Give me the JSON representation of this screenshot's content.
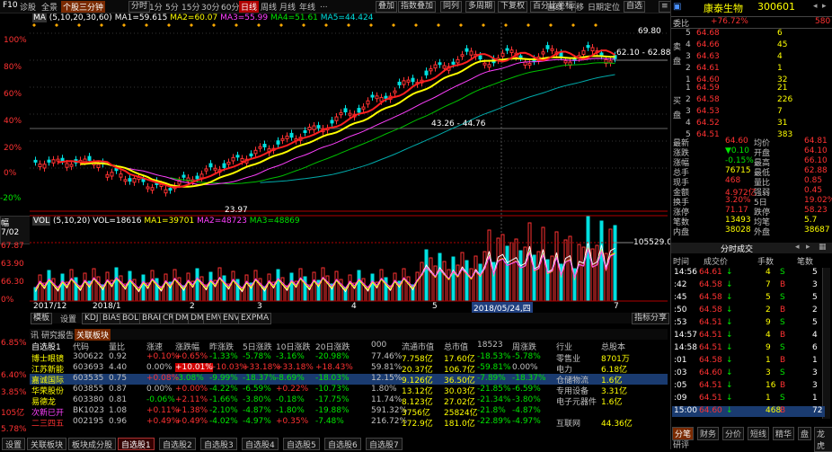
{
  "toolbar": {
    "f10": "F10",
    "diagnose": "诊股",
    "full": "全景",
    "stock_trend": "个股三分钟",
    "periods": [
      "分时",
      "1分",
      "5分",
      "15分",
      "30分",
      "60分",
      "日线",
      "周线",
      "月线",
      "年线"
    ],
    "more": "...",
    "overlay": "叠加",
    "indicator_overlay": "指数叠加",
    "same_list": "同列",
    "multi_cycle": "多周期",
    "adjust": "下复权",
    "range": "百分比坐标",
    "draw": "画线",
    "pan": "平移",
    "locate": "日期定位",
    "self_select": "自选"
  },
  "ma_legend": {
    "label": "MA",
    "params": "(5,10,20,30,60)",
    "ma1": "MA1=59.615",
    "ma2": "MA2=60.07",
    "ma3": "MA3=55.99",
    "ma4": "MA4=51.61",
    "ma5": "MA5=44.424"
  },
  "vol_legend": {
    "label": "VOL",
    "params": "(5,10,20)",
    "vol": "VOL=18616",
    "ma1": "MA1=39701",
    "ma2": "MA2=48723",
    "ma3": "MA3=48869",
    "peak": "105529.00"
  },
  "price_axis": [
    "100%",
    "80%",
    "60%",
    "40%",
    "20%",
    "0%",
    "-20%"
  ],
  "price_marks": {
    "high": "69.80",
    "range": "62.10 - 62.88",
    "mid": "43.26 - 44.76",
    "low": "23.97"
  },
  "time_axis": [
    "2017/12",
    "2018/1",
    "2",
    "3",
    "4",
    "5",
    "2018/05/24,四",
    "7"
  ],
  "indicator_tabs": [
    "模板",
    "设置",
    "KDJ",
    "BIAS",
    "BOLL",
    "BRAR",
    "CR",
    "DMA",
    "DMI",
    "EMV",
    "ENV",
    "EXPMA"
  ],
  "indicator_more": "指标分享",
  "left_info": [
    "幅",
    "7/02",
    "6.85%",
    "6.40%",
    "3.85%",
    "105亿",
    "5.78%",
    "65.00",
    "67.87",
    "63.90",
    "66.30",
    "0%"
  ],
  "left_side_labels": [
    "日线",
    "设置",
    "指标"
  ],
  "news_tabs": [
    "讯",
    "研究报告",
    "关联板块"
  ],
  "stock_title": {
    "name": "康泰生物",
    "code": "300601"
  },
  "ratio": {
    "label": "委比",
    "value": "+76.72%",
    "diff_label": "",
    "diff": "580"
  },
  "sell_orders": [
    {
      "level": "5",
      "price": "64.68",
      "vol": "6"
    },
    {
      "level": "4",
      "price": "64.66",
      "vol": "45"
    },
    {
      "level": "3",
      "price": "64.63",
      "vol": "4"
    },
    {
      "level": "2",
      "price": "64.61",
      "vol": "1"
    },
    {
      "level": "1",
      "price": "64.60",
      "vol": "32"
    }
  ],
  "buy_orders": [
    {
      "level": "1",
      "price": "64.59",
      "vol": "21"
    },
    {
      "level": "2",
      "price": "64.58",
      "vol": "226"
    },
    {
      "level": "3",
      "price": "64.53",
      "vol": "7"
    },
    {
      "level": "4",
      "price": "64.52",
      "vol": "31"
    },
    {
      "level": "5",
      "price": "64.51",
      "vol": "383"
    }
  ],
  "side_labels": {
    "sell": "卖盘",
    "buy": "买盘"
  },
  "quote": [
    [
      "最新",
      "64.60",
      "均价",
      "64.81"
    ],
    [
      "涨跌",
      "▼0.10",
      "开盘",
      "64.10"
    ],
    [
      "涨幅",
      "-0.15%",
      "最高",
      "66.10"
    ],
    [
      "总手",
      "76715",
      "最低",
      "62.88"
    ],
    [
      "现手",
      "468",
      "量比",
      "0.85"
    ],
    [
      "金额",
      "4.972亿",
      "强弱",
      "0.45"
    ],
    [
      "换手",
      "3.20%",
      "5日",
      "19.02%"
    ],
    [
      "涨停",
      "71.17",
      "跌停",
      "58.23"
    ],
    [
      "笔数",
      "13493",
      "均笔",
      "5.7"
    ],
    [
      "内盘",
      "38028",
      "外盘",
      "38687"
    ]
  ],
  "ticks_title": "分时成交",
  "ticks_header": [
    "时间",
    "成交价",
    "手数",
    "笔数"
  ],
  "ticks": [
    [
      "14:56",
      "64.61",
      "4",
      "5"
    ],
    [
      ":42",
      "64.58",
      "7",
      "3"
    ],
    [
      ":45",
      "64.58",
      "5",
      "5"
    ],
    [
      ":50",
      "64.58",
      "2",
      "2"
    ],
    [
      ":53",
      "64.51",
      "9",
      "5"
    ],
    [
      "14:57",
      "64.51",
      "4",
      "4"
    ],
    [
      "14:58",
      "64.51",
      "9",
      "6"
    ],
    [
      ":01",
      "64.58",
      "1",
      "1"
    ],
    [
      ":03",
      "64.60",
      "3",
      "3"
    ],
    [
      ":05",
      "64.51",
      "16",
      "3"
    ],
    [
      ":09",
      "64.51",
      "1",
      "1"
    ],
    [
      "15:00",
      "64.60",
      "468",
      "72"
    ]
  ],
  "bottom_right_tabs": [
    "分笔",
    "财务",
    "分价",
    "短线",
    "精华",
    "盘",
    "龙虎"
  ],
  "bottom_right_extra": "研评",
  "table_header": [
    "自选股1",
    "代码",
    "量比",
    "涨速",
    "涨跌幅",
    "昨涨跌",
    "5日涨跌",
    "10日涨跌",
    "20日涨跌",
    "000",
    "流通市值",
    "总市值",
    "18523",
    "周涨跌",
    "行业",
    "总股本"
  ],
  "table_rows": [
    [
      "博士眼镜",
      "300622",
      "0.92",
      "+0.10%",
      "+0.65%",
      "-1.33%",
      "-5.78%",
      "-3.16%",
      "-20.98%",
      "77.46%",
      "7.758亿",
      "17.60亿",
      "-18.53%",
      "-5.78%",
      "零售业",
      "8701万"
    ],
    [
      "江苏新能",
      "603693",
      "4.40",
      "0.00%",
      "+10.01%",
      "+10.03%",
      "+33.18%",
      "+33.18%",
      "+18.43%",
      "59.81%",
      "20.37亿",
      "106.7亿",
      "-59.81%",
      "0.00%",
      "电力",
      "6.18亿"
    ],
    [
      "嘉诚国际",
      "603535",
      "0.75",
      "+0.08%",
      "-3.08%",
      "-9.99%",
      "-18.37%",
      "-8.69%",
      "-18.03%",
      "12.15%",
      "9.126亿",
      "36.50亿",
      "-7.89%",
      "-18.37%",
      "仓储物流",
      "1.6亿"
    ],
    [
      "华荣股份",
      "603855",
      "0.87",
      "0.00%",
      "+0.00%",
      "-4.22%",
      "-6.59%",
      "+0.22%",
      "-10.73%",
      "1.80%",
      "13.12亿",
      "30.03亿",
      "-21.85%",
      "-6.59%",
      "专用设备",
      "3.31亿"
    ],
    [
      "易德龙",
      "603380",
      "0.81",
      "-0.06%",
      "+2.11%",
      "-1.66%",
      "-3.80%",
      "-0.18%",
      "-17.75%",
      "11.74%",
      "8.123亿",
      "27.02亿",
      "-21.34%",
      "-3.80%",
      "电子元器件",
      "1.6亿"
    ],
    [
      "次新已开",
      "BK1023",
      "1.08",
      "+0.11%",
      "+1.38%",
      "-2.10%",
      "-4.87%",
      "-1.80%",
      "-19.88%",
      "591.32%",
      "3756亿",
      "25824亿",
      "-21.8%",
      "-4.87%",
      "",
      ""
    ],
    [
      "二三四五",
      "002195",
      "0.96",
      "+0.49%",
      "+0.49%",
      "-4.02%",
      "-4.97%",
      "+0.35%",
      "-7.48%",
      "216.72%",
      "172.9亿",
      "181.0亿",
      "-22.89%",
      "-4.97%",
      "互联网",
      "44.36亿"
    ]
  ],
  "bottom_tabs": [
    "设置",
    "关联板块",
    "板块成分股",
    "自选股1",
    "自选股2",
    "自选股3",
    "自选股4",
    "自选股5",
    "自选股6",
    "自选股7"
  ],
  "chart_data": {
    "type": "candlestick",
    "ma": [
      59.615,
      60.07,
      55.99,
      51.61,
      44.424
    ],
    "volume_peak": 105529,
    "high_mark": 69.8,
    "low_mark": 23.97
  },
  "colors": {
    "up": "#ff3232",
    "down": "#00e0e0",
    "ma1": "#ffffff",
    "ma2": "#ffff00",
    "ma3": "#ff40ff",
    "ma4": "#00ff00",
    "ma5": "#00aaaa"
  }
}
